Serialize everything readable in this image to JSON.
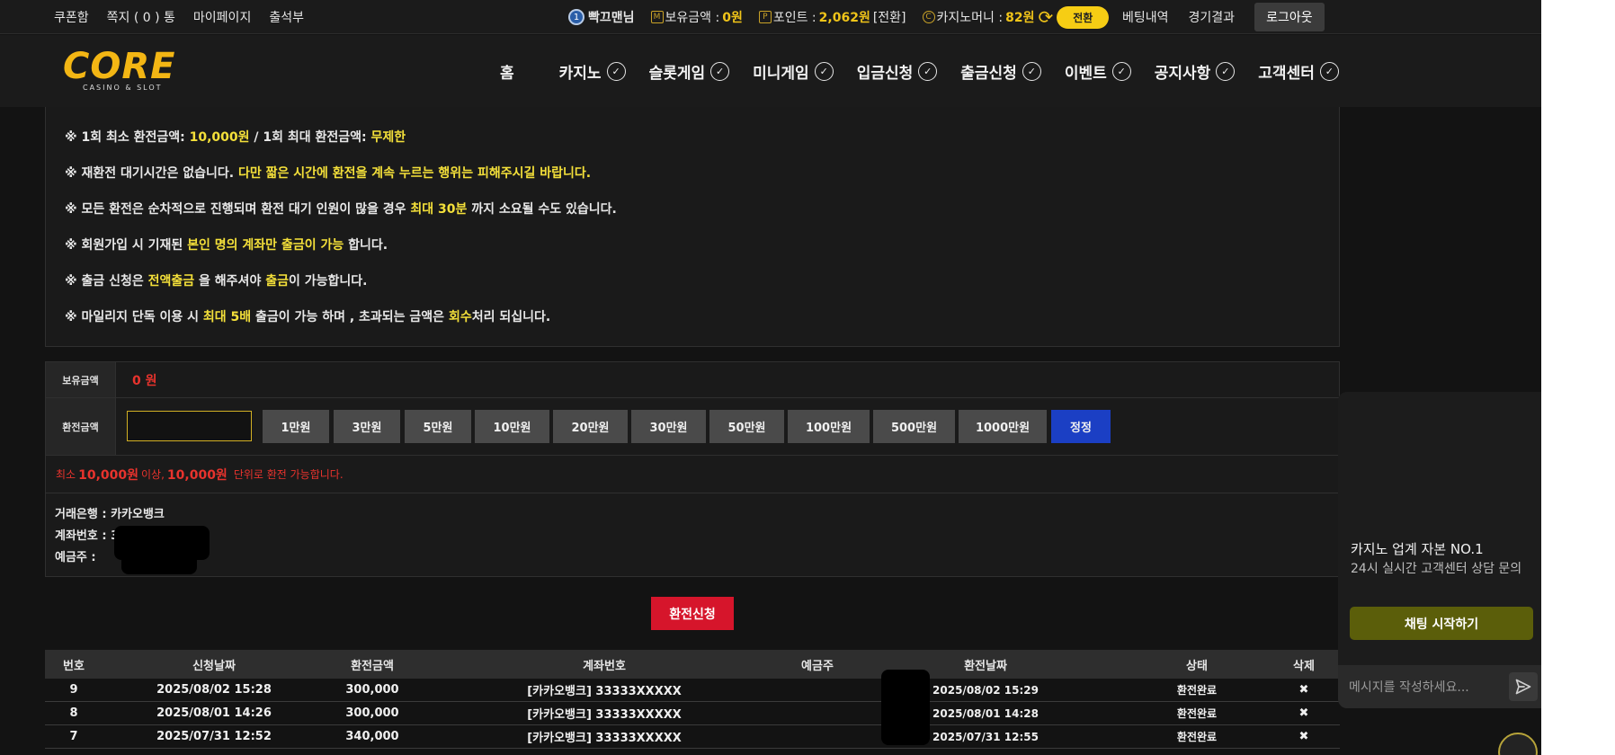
{
  "topbar": {
    "links_left": [
      "쿠폰함",
      "쪽지 ( 0 ) 통",
      "마이페이지",
      "출석부"
    ],
    "level": "1",
    "username": "빡끄맨님",
    "balance_label": "보유금액 :",
    "balance_value": "0원",
    "point_label": "포인트 :",
    "point_value": "2,062원",
    "point_convert": "[전환]",
    "casino_label": "카지노머니 :",
    "casino_value": "82원",
    "convert_btn": "전환",
    "links_right": [
      "베팅내역",
      "경기결과"
    ],
    "logout": "로그아웃"
  },
  "logo": {
    "word": "CORE",
    "sub": "CASINO & SLOT"
  },
  "nav": [
    "홈",
    "카지노",
    "슬롯게임",
    "미니게임",
    "입금신청",
    "출금신청",
    "이벤트",
    "공지사항",
    "고객센터"
  ],
  "notices": [
    [
      {
        "t": "※ 1회 최소 환전금액: ",
        "h": false
      },
      {
        "t": "10,000원",
        "h": true
      },
      {
        "t": " / 1회 최대 환전금액: ",
        "h": false
      },
      {
        "t": "무제한",
        "h": true
      }
    ],
    [
      {
        "t": "※ 재환전 대기시간은 없습니다. ",
        "h": false
      },
      {
        "t": "다만 짧은 시간에 환전을 계속 누르는 행위는 피해주시길 바랍니다.",
        "h": true
      }
    ],
    [
      {
        "t": "※ 모든 환전은 순차적으로 진행되며 환전 대기 인원이 많을 경우 ",
        "h": false
      },
      {
        "t": "최대 30분",
        "h": true
      },
      {
        "t": " 까지 소요될 수도 있습니다.",
        "h": false
      }
    ],
    [
      {
        "t": "※ 회원가입 시 기재된 ",
        "h": false
      },
      {
        "t": "본인 명의 계좌만 출금이 가능",
        "h": true
      },
      {
        "t": " 합니다.",
        "h": false
      }
    ],
    [
      {
        "t": "※ 출금 신청은 ",
        "h": false
      },
      {
        "t": "전액출금",
        "h": true
      },
      {
        "t": " 을 해주셔야 ",
        "h": false
      },
      {
        "t": "출금",
        "h": true
      },
      {
        "t": "이 가능합니다.",
        "h": false
      }
    ],
    [
      {
        "t": "※ 마일리지 단독 이용 시 ",
        "h": false
      },
      {
        "t": "최대 5배",
        "h": true
      },
      {
        "t": " 출금이 가능 하며 , 초과되는 금액은 ",
        "h": false
      },
      {
        "t": "회수",
        "h": true
      },
      {
        "t": "처리 되십니다.",
        "h": false
      }
    ]
  ],
  "form": {
    "balance_label": "보유금액",
    "balance_value": "0 원",
    "amount_label": "환전금액",
    "amount_value": "",
    "amount_buttons": [
      "1만원",
      "3만원",
      "5만원",
      "10만원",
      "20만원",
      "30만원",
      "50만원",
      "100만원",
      "500만원",
      "1000만원"
    ],
    "reset_button": "정정",
    "min_prefix": "최소",
    "min_amount": "10,000원",
    "min_mid": "이상,",
    "unit_amount": "10,000원",
    "min_suffix": "단위로 환전 가능합니다.",
    "bank_line": "거래은행 : 카카오뱅크",
    "account_line": "계좌번호 : 33",
    "holder_line": "예금주 : "
  },
  "apply_button": "환전신청",
  "history": {
    "headers": [
      "번호",
      "신청날짜",
      "환전금액",
      "계좌번호",
      "예금주",
      "환전날짜",
      "상태",
      "삭제"
    ],
    "rows": [
      [
        "9",
        "2025/08/02 15:28",
        "300,000",
        "[카카오뱅크] 33333XXXXX",
        "",
        "2025/08/02 15:29",
        "환전완료",
        "✖"
      ],
      [
        "8",
        "2025/08/01 14:26",
        "300,000",
        "[카카오뱅크] 33333XXXXX",
        "",
        "2025/08/01 14:28",
        "환전완료",
        "✖"
      ],
      [
        "7",
        "2025/07/31 12:52",
        "340,000",
        "[카카오뱅크] 33333XXXXX",
        "",
        "2025/07/31 12:55",
        "환전완료",
        "✖"
      ]
    ]
  },
  "chat": {
    "title": "카지노 업계 자본 NO.1",
    "subtitle": "24시 실시간 고객센터 상담 문의",
    "start_button": "채팅 시작하기",
    "placeholder": "메시지를 작성하세요..."
  },
  "icons": [
    "level-badge-icon",
    "money-icon",
    "point-icon",
    "casino-coin-icon",
    "refresh-icon",
    "check-circle-icon",
    "send-icon"
  ],
  "colors": {
    "gold": "#f0c419",
    "highlight": "#f4e03a",
    "red": "#e8332d",
    "apply": "#d6152b",
    "reset": "#1b3fc4",
    "chat_btn": "#5b5e0a"
  }
}
